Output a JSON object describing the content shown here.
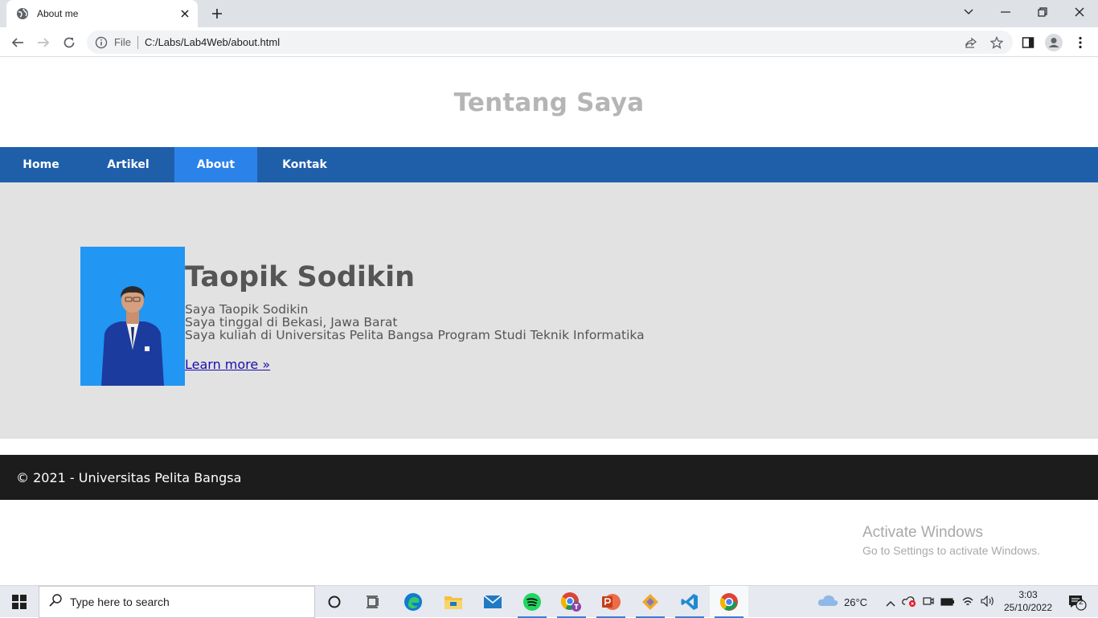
{
  "browser": {
    "tab_title": "About me",
    "scheme_label": "File",
    "url": "C:/Labs/Lab4Web/about.html"
  },
  "site": {
    "title": "Tentang Saya",
    "nav": [
      {
        "label": "Home"
      },
      {
        "label": "Artikel"
      },
      {
        "label": "About"
      },
      {
        "label": "Kontak"
      }
    ],
    "profile": {
      "name": "Taopik Sodikin",
      "lines": [
        "Saya Taopik Sodikin",
        "Saya tinggal di Bekasi, Jawa Barat",
        "Saya kuliah di Universitas Pelita Bangsa Program Studi Teknik Informatika"
      ],
      "learn_more": "Learn more »"
    },
    "footer": "© 2021 - Universitas Pelita Bangsa"
  },
  "watermark": {
    "line1": "Activate Windows",
    "line2": "Go to Settings to activate Windows."
  },
  "taskbar": {
    "search_placeholder": "Type here to search",
    "weather": "26°C",
    "time": "3:03",
    "date": "25/10/2022",
    "notification_count": "2"
  },
  "colors": {
    "nav_bg": "#1f5faa",
    "nav_active": "#2b83ea",
    "content_bg": "#e2e2e2",
    "footer_bg": "#1c1c1c",
    "photo_bg": "#2196f3"
  }
}
